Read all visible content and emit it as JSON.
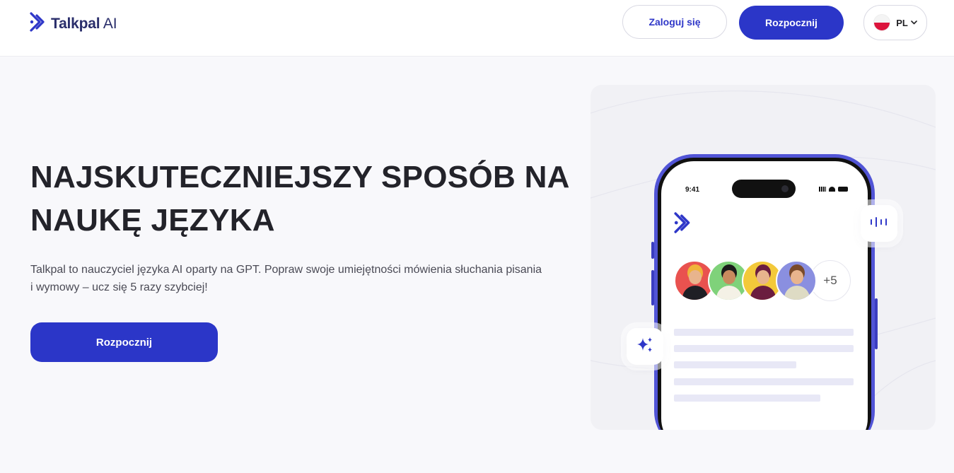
{
  "header": {
    "brand_name": "Talkpal",
    "brand_suffix": "AI",
    "login_label": "Zaloguj się",
    "start_label": "Rozpocznij",
    "language_code": "PL"
  },
  "hero": {
    "title_line1": "NAJSKUTECZNIEJSZY SPOSÓB NA",
    "title_line2": "NAUKĘ JĘZYKA",
    "subtitle_line1": "Talkpal to nauczyciel języka AI oparty na GPT. Popraw swoje umiejętności mówienia słuchania pisania",
    "subtitle_line2": "i wymowy – ucz się 5 razy szybciej!",
    "cta_label": "Rozpocznij"
  },
  "phone": {
    "time": "9:41",
    "more_count": "+5",
    "icons": [
      "logo-icon",
      "voice-wave-icon",
      "sparkle-icon",
      "signal-icon",
      "wifi-icon",
      "battery-icon"
    ]
  },
  "colors": {
    "brand": "#2b36c8",
    "phone_frame": "#5154d6",
    "avatar_bgs": [
      "#e9524f",
      "#7fd27a",
      "#f3c93a",
      "#8a8fe0"
    ]
  }
}
